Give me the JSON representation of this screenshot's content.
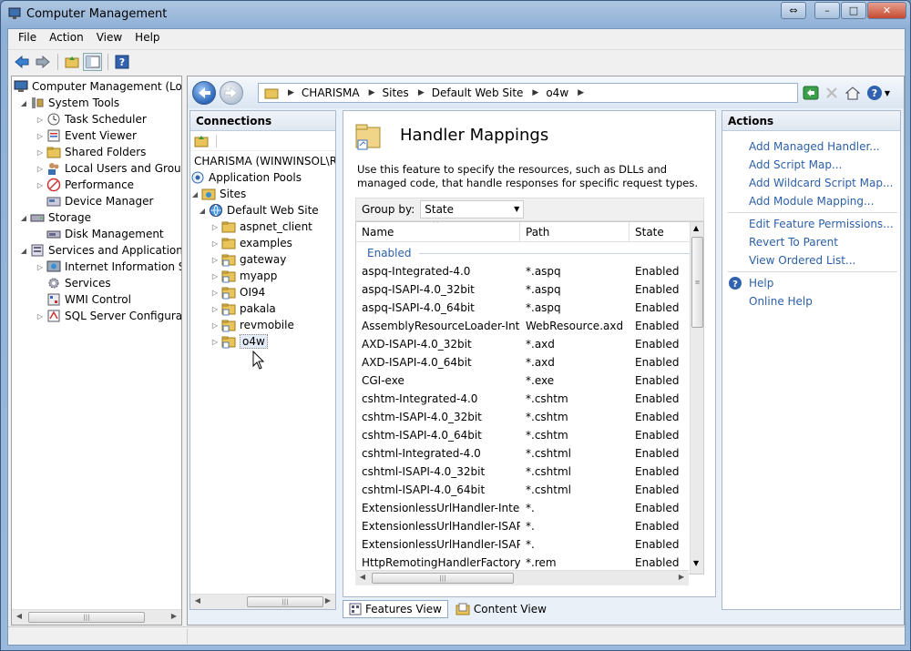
{
  "window": {
    "title": "Computer Management",
    "controls": [
      "⇔",
      "–",
      "□",
      "✕"
    ]
  },
  "menu": [
    "File",
    "Action",
    "View",
    "Help"
  ],
  "toolbar": {
    "icons": [
      "back-icon",
      "forward-icon",
      "up-folder-icon",
      "show-hide-tree-icon",
      "help-icon"
    ]
  },
  "tree": [
    {
      "label": "Computer Management (Local",
      "level": 0,
      "expander": "",
      "icon": "computer"
    },
    {
      "label": "System Tools",
      "level": 1,
      "expander": "◢",
      "icon": "tools"
    },
    {
      "label": "Task Scheduler",
      "level": 2,
      "expander": "▷",
      "icon": "clock"
    },
    {
      "label": "Event Viewer",
      "level": 2,
      "expander": "▷",
      "icon": "viewer"
    },
    {
      "label": "Shared Folders",
      "level": 2,
      "expander": "▷",
      "icon": "folder"
    },
    {
      "label": "Local Users and Groups",
      "level": 2,
      "expander": "▷",
      "icon": "users"
    },
    {
      "label": "Performance",
      "level": 2,
      "expander": "▷",
      "icon": "perf"
    },
    {
      "label": "Device Manager",
      "level": 2,
      "expander": "",
      "icon": "device"
    },
    {
      "label": "Storage",
      "level": 1,
      "expander": "◢",
      "icon": "storage"
    },
    {
      "label": "Disk Management",
      "level": 2,
      "expander": "",
      "icon": "disk"
    },
    {
      "label": "Services and Applications",
      "level": 1,
      "expander": "◢",
      "icon": "services"
    },
    {
      "label": "Internet Information Ser",
      "level": 2,
      "expander": "▷",
      "icon": "iis"
    },
    {
      "label": "Services",
      "level": 2,
      "expander": "",
      "icon": "gear"
    },
    {
      "label": "WMI Control",
      "level": 2,
      "expander": "",
      "icon": "wmi"
    },
    {
      "label": "SQL Server Configuratic",
      "level": 2,
      "expander": "▷",
      "icon": "sql"
    }
  ],
  "address": {
    "crumbs": [
      "CHARISMA",
      "Sites",
      "Default Web Site",
      "o4w"
    ]
  },
  "connections": {
    "header": "Connections",
    "items": [
      {
        "label": "CHARISMA (WINWINSOL\\RC",
        "level": 0,
        "expander": "",
        "icon": "server"
      },
      {
        "label": "Application Pools",
        "level": 0,
        "expander": "",
        "icon": "pools"
      },
      {
        "label": "Sites",
        "level": 0,
        "expander": "◢",
        "icon": "sites"
      },
      {
        "label": "Default Web Site",
        "level": 1,
        "expander": "◢",
        "icon": "globe"
      },
      {
        "label": "aspnet_client",
        "level": 2,
        "expander": "▷",
        "icon": "folder"
      },
      {
        "label": "examples",
        "level": 2,
        "expander": "▷",
        "icon": "folder"
      },
      {
        "label": "gateway",
        "level": 2,
        "expander": "▷",
        "icon": "app"
      },
      {
        "label": "myapp",
        "level": 2,
        "expander": "▷",
        "icon": "app"
      },
      {
        "label": "OI94",
        "level": 2,
        "expander": "▷",
        "icon": "app"
      },
      {
        "label": "pakala",
        "level": 2,
        "expander": "▷",
        "icon": "app"
      },
      {
        "label": "revmobile",
        "level": 2,
        "expander": "▷",
        "icon": "app"
      },
      {
        "label": "o4w",
        "level": 2,
        "expander": "▷",
        "icon": "app",
        "selected": true
      }
    ]
  },
  "feature": {
    "title": "Handler Mappings",
    "description": "Use this feature to specify the resources, such as DLLs and managed code, that handle responses for specific request types.",
    "group_by_label": "Group by:",
    "group_by_value": "State",
    "columns": [
      "Name",
      "Path",
      "State"
    ],
    "group_header": "Enabled",
    "rows": [
      {
        "name": "aspq-Integrated-4.0",
        "path": "*.aspq",
        "state": "Enabled"
      },
      {
        "name": "aspq-ISAPI-4.0_32bit",
        "path": "*.aspq",
        "state": "Enabled"
      },
      {
        "name": "aspq-ISAPI-4.0_64bit",
        "path": "*.aspq",
        "state": "Enabled"
      },
      {
        "name": "AssemblyResourceLoader-Inte...",
        "path": "WebResource.axd",
        "state": "Enabled"
      },
      {
        "name": "AXD-ISAPI-4.0_32bit",
        "path": "*.axd",
        "state": "Enabled"
      },
      {
        "name": "AXD-ISAPI-4.0_64bit",
        "path": "*.axd",
        "state": "Enabled"
      },
      {
        "name": "CGI-exe",
        "path": "*.exe",
        "state": "Enabled"
      },
      {
        "name": "cshtm-Integrated-4.0",
        "path": "*.cshtm",
        "state": "Enabled"
      },
      {
        "name": "cshtm-ISAPI-4.0_32bit",
        "path": "*.cshtm",
        "state": "Enabled"
      },
      {
        "name": "cshtm-ISAPI-4.0_64bit",
        "path": "*.cshtm",
        "state": "Enabled"
      },
      {
        "name": "cshtml-Integrated-4.0",
        "path": "*.cshtml",
        "state": "Enabled"
      },
      {
        "name": "cshtml-ISAPI-4.0_32bit",
        "path": "*.cshtml",
        "state": "Enabled"
      },
      {
        "name": "cshtml-ISAPI-4.0_64bit",
        "path": "*.cshtml",
        "state": "Enabled"
      },
      {
        "name": "ExtensionlessUrlHandler-Integ...",
        "path": "*.",
        "state": "Enabled"
      },
      {
        "name": "ExtensionlessUrlHandler-ISAPI...",
        "path": "*.",
        "state": "Enabled"
      },
      {
        "name": "ExtensionlessUrlHandler-ISAPI...",
        "path": "*.",
        "state": "Enabled"
      },
      {
        "name": "HttpRemotingHandlerFactory...",
        "path": "*.rem",
        "state": "Enabled"
      }
    ]
  },
  "views": {
    "features": "Features View",
    "content": "Content View"
  },
  "actions": {
    "header": "Actions",
    "group1": [
      "Add Managed Handler...",
      "Add Script Map...",
      "Add Wildcard Script Map...",
      "Add Module Mapping..."
    ],
    "group2": [
      "Edit Feature Permissions...",
      "Revert To Parent",
      "View Ordered List..."
    ],
    "help": "Help",
    "online_help": "Online Help"
  },
  "colors": {
    "link": "#2c5fa8",
    "accent": "#3b6fb6"
  }
}
